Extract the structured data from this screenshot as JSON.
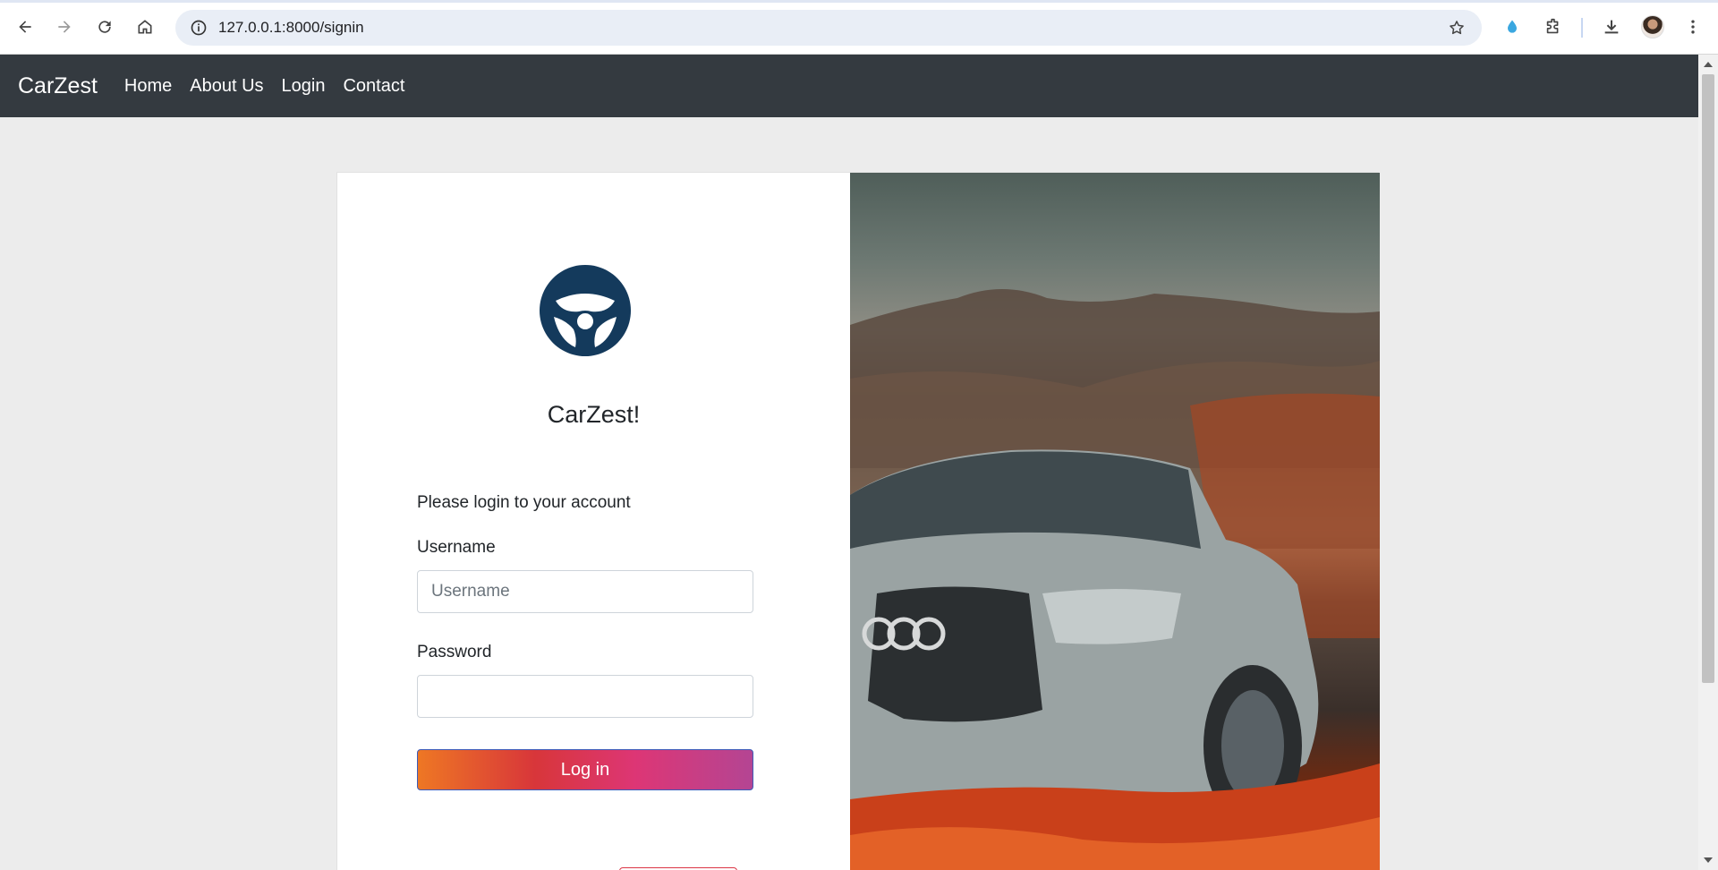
{
  "browser": {
    "url": "127.0.0.1:8000/signin"
  },
  "navbar": {
    "brand": "CarZest",
    "links": [
      "Home",
      "About Us",
      "Login",
      "Contact"
    ]
  },
  "login": {
    "title": "CarZest!",
    "prompt": "Please login to your account",
    "username_label": "Username",
    "username_placeholder": "Username",
    "password_label": "Password",
    "button_label": "Log in"
  },
  "colors": {
    "navbar_bg": "#343a40",
    "logo": "#143a5c",
    "button_gradient_start": "#ee7724",
    "button_gradient_end": "#b44593"
  },
  "icons": [
    "back-icon",
    "forward-icon",
    "reload-icon",
    "home-icon",
    "site-info-icon",
    "bookmark-star-icon",
    "extension-drop-icon",
    "extensions-puzzle-icon",
    "download-icon",
    "menu-kebab-icon",
    "steering-wheel-icon"
  ]
}
